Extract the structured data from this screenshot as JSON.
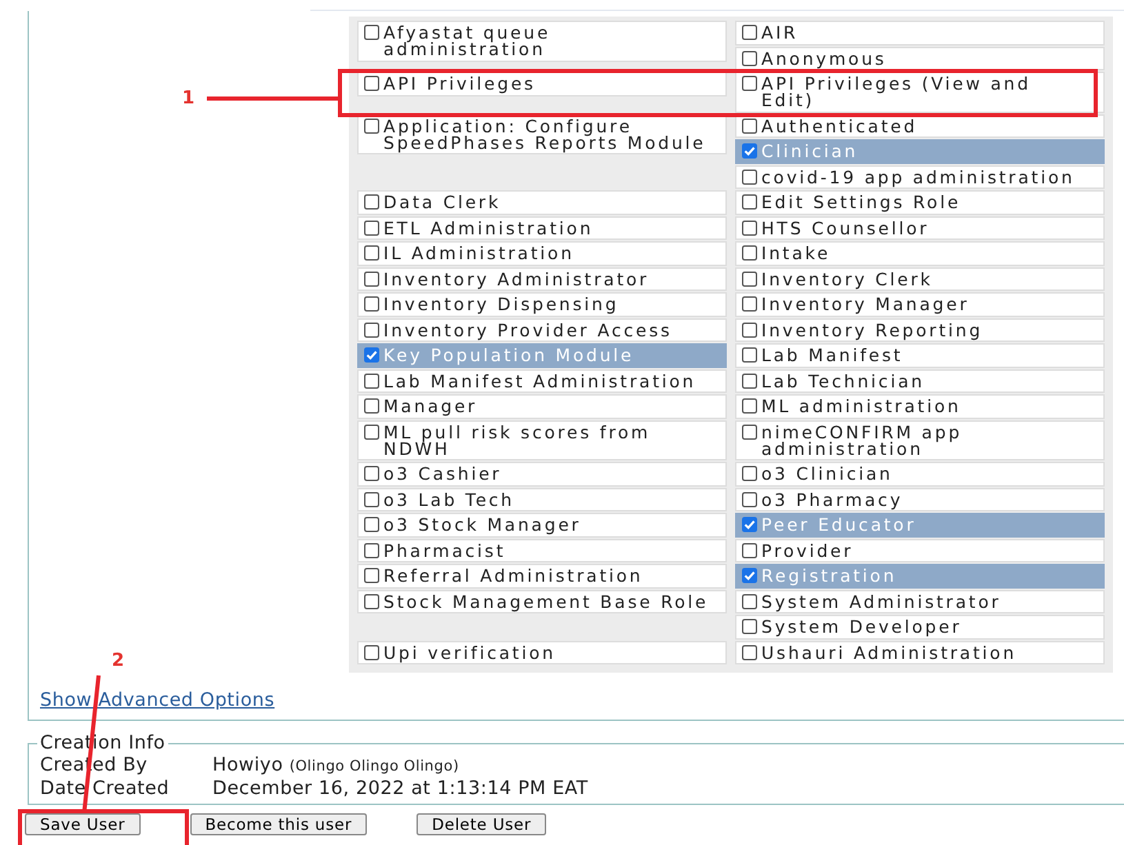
{
  "roles": [
    {
      "left": [
        {
          "label": "Afyastat queue administration",
          "checked": false
        }
      ],
      "right": [
        {
          "label": "AIR",
          "checked": false
        },
        {
          "label": "Anonymous",
          "checked": false
        }
      ]
    },
    {
      "left": [
        {
          "label": "API Privileges",
          "checked": false
        }
      ],
      "right": [
        {
          "label": "API Privileges (View and Edit)",
          "checked": false
        }
      ]
    },
    {
      "left": [
        {
          "label": "Application: Configure SpeedPhases Reports Module",
          "checked": false
        }
      ],
      "right": [
        {
          "label": "Authenticated",
          "checked": false
        },
        {
          "label": "Clinician",
          "checked": true
        },
        {
          "label": "covid-19 app administration",
          "checked": false
        }
      ]
    },
    {
      "left": [
        {
          "label": "Data Clerk",
          "checked": false
        }
      ],
      "right": [
        {
          "label": "Edit Settings Role",
          "checked": false
        }
      ]
    },
    {
      "left": [
        {
          "label": "ETL Administration",
          "checked": false
        }
      ],
      "right": [
        {
          "label": "HTS Counsellor",
          "checked": false
        }
      ]
    },
    {
      "left": [
        {
          "label": "IL Administration",
          "checked": false
        }
      ],
      "right": [
        {
          "label": "Intake",
          "checked": false
        }
      ]
    },
    {
      "left": [
        {
          "label": "Inventory Administrator",
          "checked": false
        }
      ],
      "right": [
        {
          "label": "Inventory Clerk",
          "checked": false
        }
      ]
    },
    {
      "left": [
        {
          "label": "Inventory Dispensing",
          "checked": false
        }
      ],
      "right": [
        {
          "label": "Inventory Manager",
          "checked": false
        }
      ]
    },
    {
      "left": [
        {
          "label": "Inventory Provider Access",
          "checked": false
        }
      ],
      "right": [
        {
          "label": "Inventory Reporting",
          "checked": false
        }
      ]
    },
    {
      "left": [
        {
          "label": "Key Population Module",
          "checked": true
        }
      ],
      "right": [
        {
          "label": "Lab Manifest",
          "checked": false
        }
      ]
    },
    {
      "left": [
        {
          "label": "Lab Manifest Administration",
          "checked": false
        }
      ],
      "right": [
        {
          "label": "Lab Technician",
          "checked": false
        }
      ]
    },
    {
      "left": [
        {
          "label": "Manager",
          "checked": false
        }
      ],
      "right": [
        {
          "label": "ML administration",
          "checked": false
        }
      ]
    },
    {
      "left": [
        {
          "label": "ML pull risk scores from NDWH",
          "checked": false
        }
      ],
      "right": [
        {
          "label": "nimeCONFIRM app administration",
          "checked": false
        }
      ]
    },
    {
      "left": [
        {
          "label": "o3 Cashier",
          "checked": false
        }
      ],
      "right": [
        {
          "label": "o3 Clinician",
          "checked": false
        }
      ]
    },
    {
      "left": [
        {
          "label": "o3 Lab Tech",
          "checked": false
        }
      ],
      "right": [
        {
          "label": "o3 Pharmacy",
          "checked": false
        }
      ]
    },
    {
      "left": [
        {
          "label": "o3 Stock Manager",
          "checked": false
        }
      ],
      "right": [
        {
          "label": "Peer Educator",
          "checked": true
        }
      ]
    },
    {
      "left": [
        {
          "label": "Pharmacist",
          "checked": false
        }
      ],
      "right": [
        {
          "label": "Provider",
          "checked": false
        }
      ]
    },
    {
      "left": [
        {
          "label": "Referral Administration",
          "checked": false
        }
      ],
      "right": [
        {
          "label": "Registration",
          "checked": true
        }
      ]
    },
    {
      "left": [
        {
          "label": "Stock Management Base Role",
          "checked": false
        }
      ],
      "right": [
        {
          "label": "System Administrator",
          "checked": false
        },
        {
          "label": "System Developer",
          "checked": false
        }
      ]
    },
    {
      "left": [
        {
          "label": "Upi verification",
          "checked": false
        }
      ],
      "right": [
        {
          "label": "Ushauri Administration",
          "checked": false
        }
      ]
    }
  ],
  "advanced_link": "Show Advanced Options",
  "creation_info": {
    "legend": "Creation Info",
    "created_by_label": "Created By",
    "created_by": "Howiyo",
    "created_by_name": "(Olingo Olingo Olingo)",
    "date_created_label": "Date Created",
    "date_created": "December 16, 2022 at 1:13:14 PM EAT"
  },
  "buttons": [
    "Save User",
    "Become this user",
    "Delete User"
  ],
  "annotations": [
    {
      "number": "1"
    },
    {
      "number": "2"
    }
  ]
}
